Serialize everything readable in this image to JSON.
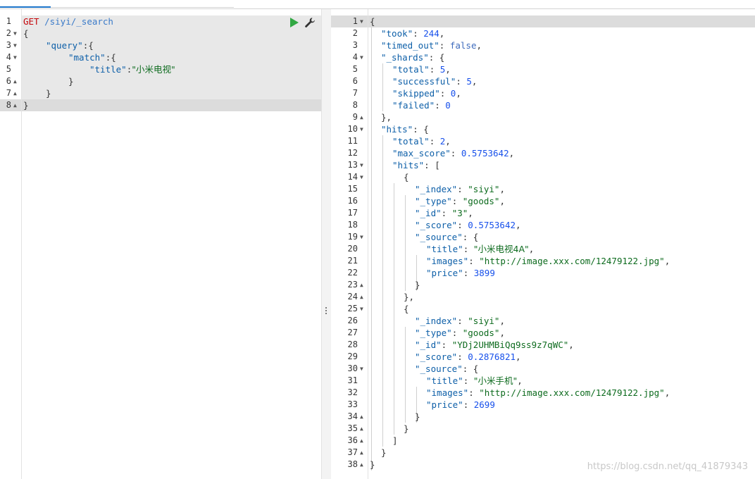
{
  "request": {
    "method": "GET",
    "path": "/siyi/_search",
    "line_numbers": [
      "1",
      "2",
      "3",
      "4",
      "5",
      "6",
      "7",
      "8"
    ],
    "tokens": {
      "open_brace": "{",
      "query_key": "\"query\"",
      "match_key": "\"match\"",
      "title_key": "\"title\"",
      "title_value": "\"小米电视\"",
      "colon_brace": ":{",
      "colon": ":",
      "close_brace": "}"
    }
  },
  "response": {
    "line_numbers": [
      "1",
      "2",
      "3",
      "4",
      "5",
      "6",
      "7",
      "8",
      "9",
      "10",
      "11",
      "12",
      "13",
      "14",
      "15",
      "16",
      "17",
      "18",
      "19",
      "20",
      "21",
      "22",
      "23",
      "24",
      "25",
      "26",
      "27",
      "28",
      "29",
      "30",
      "31",
      "32",
      "33",
      "34",
      "35",
      "36",
      "37",
      "38"
    ],
    "took": "244",
    "timed_out": "false",
    "shards": {
      "total": "5",
      "successful": "5",
      "skipped": "0",
      "failed": "0"
    },
    "hits": {
      "total": "2",
      "max_score": "0.5753642",
      "items": [
        {
          "index": "\"siyi\"",
          "type": "\"goods\"",
          "id": "\"3\"",
          "score": "0.5753642",
          "source": {
            "title": "\"小米电视4A\"",
            "images": "\"http://image.xxx.com/12479122.jpg\"",
            "price": "3899"
          }
        },
        {
          "index": "\"siyi\"",
          "type": "\"goods\"",
          "id": "\"YDj2UHMBiQq9ss9z7qWC\"",
          "score": "0.2876821",
          "source": {
            "title": "\"小米手机\"",
            "images": "\"http://image.xxx.com/12479122.jpg\"",
            "price": "2699"
          }
        }
      ]
    },
    "keys": {
      "took": "\"took\"",
      "timed_out": "\"timed_out\"",
      "shards": "\"_shards\"",
      "total": "\"total\"",
      "successful": "\"successful\"",
      "skipped": "\"skipped\"",
      "failed": "\"failed\"",
      "hits": "\"hits\"",
      "max_score": "\"max_score\"",
      "index": "\"_index\"",
      "type": "\"_type\"",
      "id": "\"_id\"",
      "score": "\"_score\"",
      "source": "\"_source\"",
      "title": "\"title\"",
      "images": "\"images\"",
      "price": "\"price\""
    }
  },
  "icons": {
    "run": "play-icon",
    "settings": "wrench-icon",
    "splitter": "vertical-dots-icon"
  },
  "colors": {
    "run": "#31a843",
    "method": "#c5060b",
    "url": "#3a7ac9"
  },
  "watermark": "https://blog.csdn.net/qq_41879343"
}
